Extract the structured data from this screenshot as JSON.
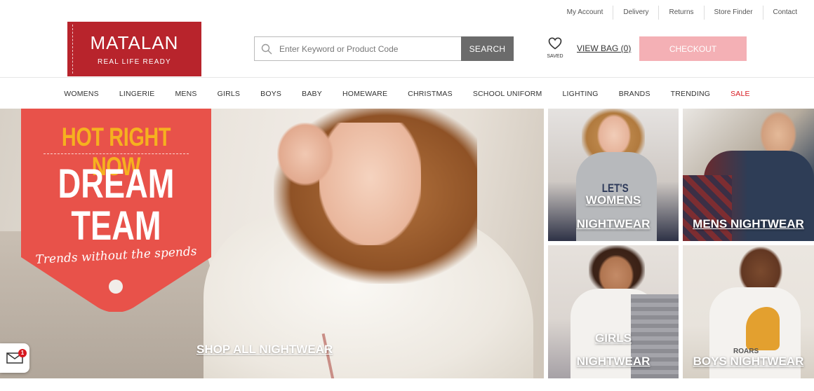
{
  "utility_links": [
    "My Account",
    "Delivery",
    "Returns",
    "Store Finder",
    "Contact"
  ],
  "logo": {
    "brand": "MATALAN",
    "tagline": "REAL LIFE READY",
    "color": "#b8242c"
  },
  "search": {
    "placeholder": "Enter Keyword or Product Code",
    "value": "",
    "button_label": "SEARCH",
    "icon": "search-icon"
  },
  "header": {
    "saved_label": "SAVED",
    "saved_icon": "heart-icon",
    "view_bag_label": "VIEW BAG (0)",
    "checkout_label": "CHECKOUT",
    "checkout_color": "#f4b0b5"
  },
  "nav": {
    "items": [
      "WOMENS",
      "LINGERIE",
      "MENS",
      "GIRLS",
      "BOYS",
      "BABY",
      "HOMEWARE",
      "CHRISTMAS",
      "SCHOOL UNIFORM",
      "LIGHTING",
      "BRANDS",
      "TRENDING",
      "SALE"
    ],
    "sale_color": "#d71920"
  },
  "hero": {
    "badge_kicker": "HOT RIGHT NOW",
    "badge_title_1": "DREAM",
    "badge_title_2": "TEAM",
    "badge_script": "Trends without the spends",
    "badge_color": "#e8524a",
    "cta": "SHOP ALL NIGHTWEAR"
  },
  "tiles": [
    {
      "line1": "WOMENS",
      "line2": "NIGHTWEAR"
    },
    {
      "line1": "MENS NIGHTWEAR"
    },
    {
      "line1": "GIRLS",
      "line2": "NIGHTWEAR"
    },
    {
      "line1": "BOYS NIGHTWEAR"
    }
  ],
  "tile_prints": {
    "womens_tee": "LET'S",
    "boys_tee": "ROARS"
  },
  "mail_widget": {
    "icon": "envelope-icon",
    "count": "1"
  }
}
